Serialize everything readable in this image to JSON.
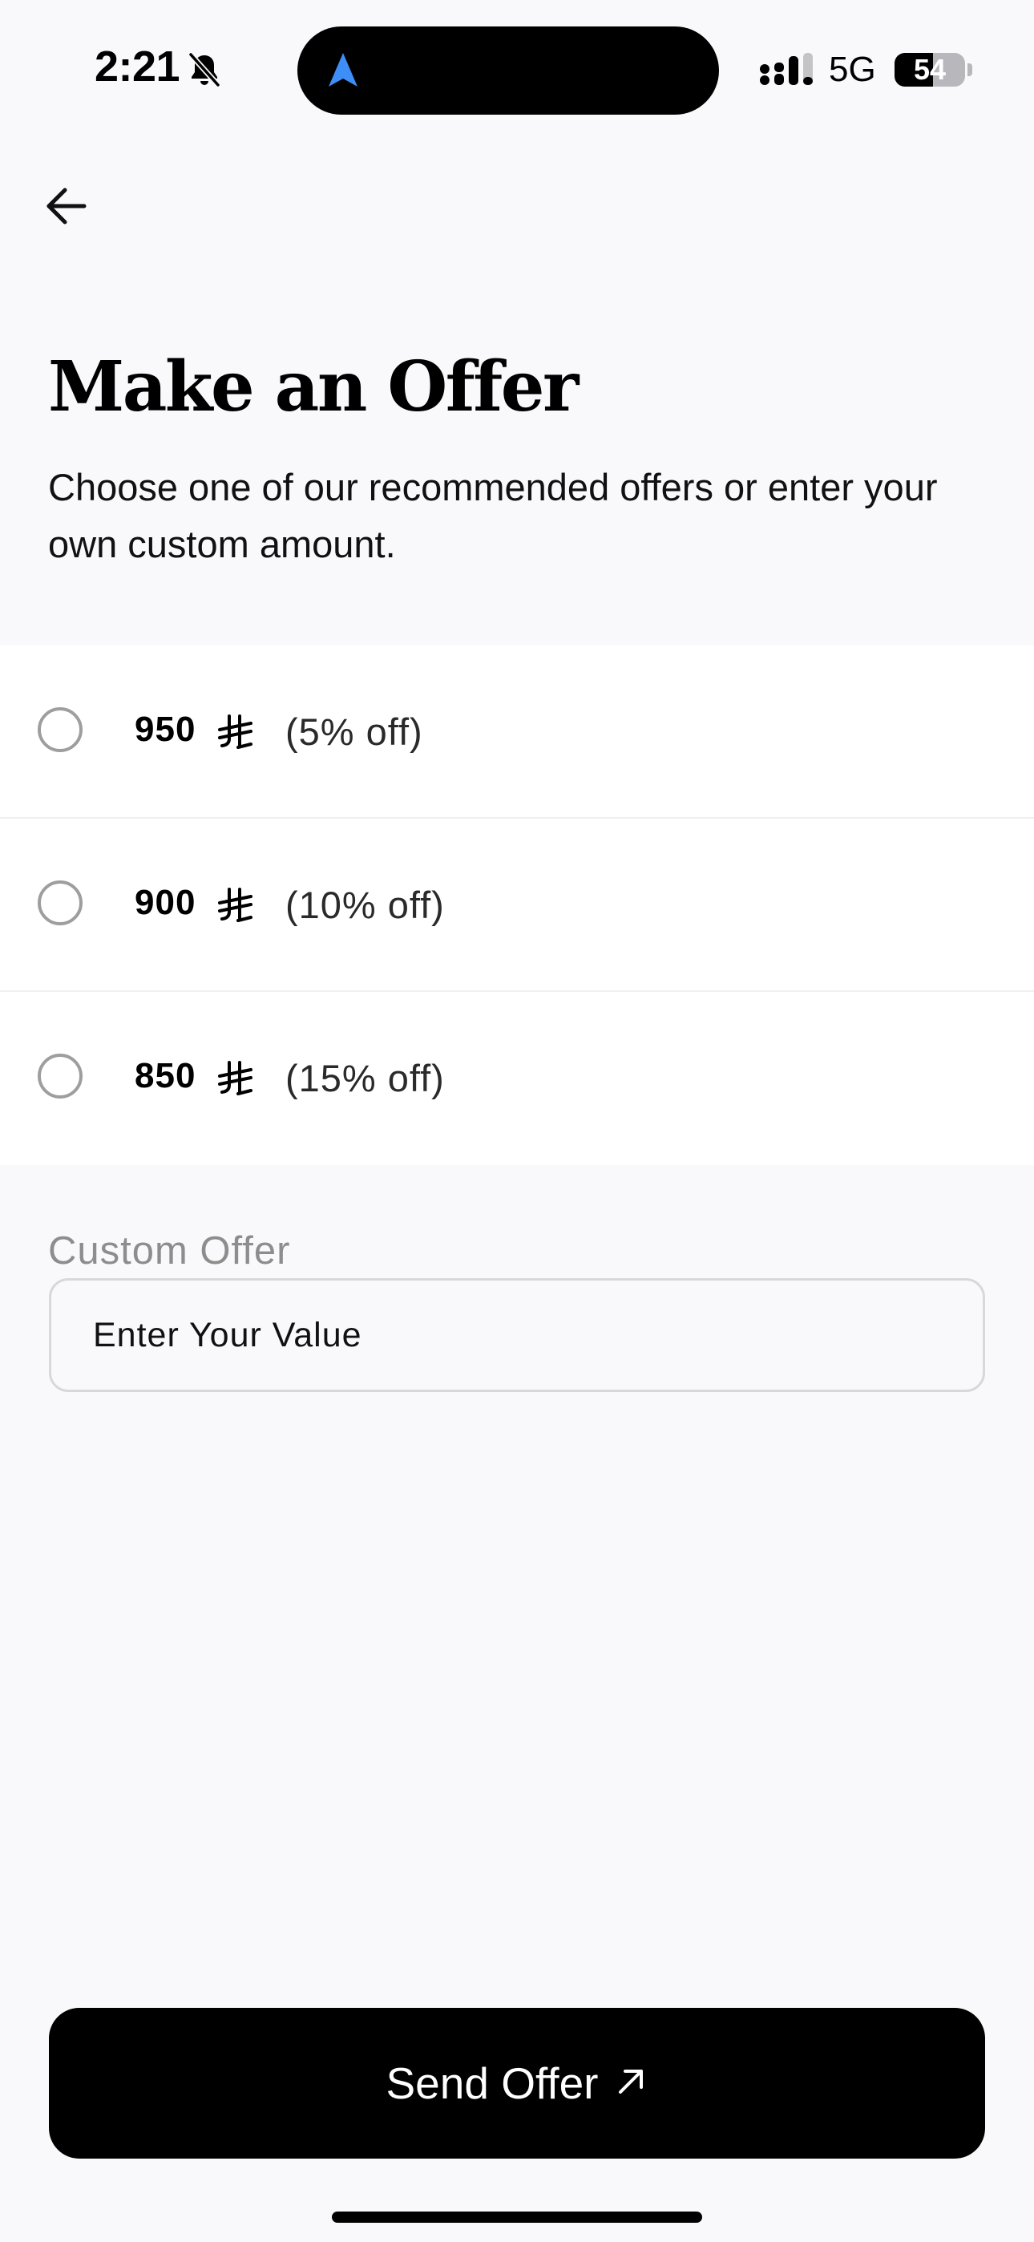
{
  "status_bar": {
    "time": "2:21",
    "network": "5G",
    "battery_level": "54",
    "battery_fraction": 0.54
  },
  "header": {
    "back_icon": "arrow-left-icon",
    "title": "Make an Offer",
    "subtitle": "Choose one of our recommended offers or enter your own custom amount."
  },
  "offers": [
    {
      "amount": "950",
      "currency_icon": "riyal-sign-icon",
      "discount": "(5% off)",
      "selected": false
    },
    {
      "amount": "900",
      "currency_icon": "riyal-sign-icon",
      "discount": "(10% off)",
      "selected": false
    },
    {
      "amount": "850",
      "currency_icon": "riyal-sign-icon",
      "discount": "(15% off)",
      "selected": false
    }
  ],
  "custom_offer": {
    "label": "Custom Offer",
    "placeholder": "Enter Your Value",
    "value": ""
  },
  "send_button": {
    "label": "Send Offer",
    "icon": "arrow-up-right-icon"
  },
  "colors": {
    "background": "#f9f9fb",
    "button": "#000000",
    "dynamic_island_accent": "#3d8ef7",
    "muted_text": "#8d8d8d"
  }
}
